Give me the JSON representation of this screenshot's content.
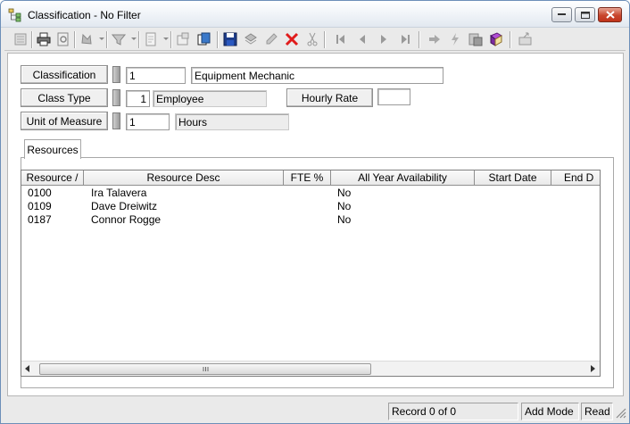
{
  "window": {
    "title": "Classification - No Filter",
    "icon": "classification-tree-icon"
  },
  "toolbar": {
    "icons": [
      "list-icon",
      "print-icon",
      "print-preview-icon",
      "search-icon",
      "filter-icon",
      "report-icon",
      "properties-icon",
      "copy-icon",
      "save-icon",
      "print-record-icon",
      "edit-icon",
      "delete-icon",
      "cut-icon",
      "first-record-icon",
      "previous-record-icon",
      "next-record-icon",
      "last-record-icon",
      "go-to-icon",
      "lightning-icon",
      "attachment-icon",
      "book-icon",
      "export-icon"
    ]
  },
  "form": {
    "classification": {
      "button": "Classification",
      "code": "1",
      "description": "Equipment Mechanic"
    },
    "class_type": {
      "button": "Class Type",
      "code": "1",
      "description": "Employee"
    },
    "hourly_rate": {
      "button": "Hourly Rate",
      "value": ""
    },
    "unit_of_measure": {
      "button": "Unit of Measure",
      "code": "1",
      "description": "Hours"
    }
  },
  "tabs": [
    {
      "label": "Resources"
    }
  ],
  "grid": {
    "columns": [
      "Resource",
      "Resource Desc",
      "FTE %",
      "All Year Availability",
      "Start Date",
      "End D"
    ],
    "rows": [
      {
        "resource": "0100",
        "desc": "Ira Talavera",
        "fte": "",
        "availability": "No",
        "start": "",
        "end": ""
      },
      {
        "resource": "0109",
        "desc": "Dave Dreiwitz",
        "fte": "",
        "availability": "No",
        "start": "",
        "end": ""
      },
      {
        "resource": "0187",
        "desc": "Connor Rogge",
        "fte": "",
        "availability": "No",
        "start": "",
        "end": ""
      }
    ]
  },
  "status": {
    "record": "Record 0 of 0",
    "mode": "Add Mode",
    "access": "Read"
  }
}
